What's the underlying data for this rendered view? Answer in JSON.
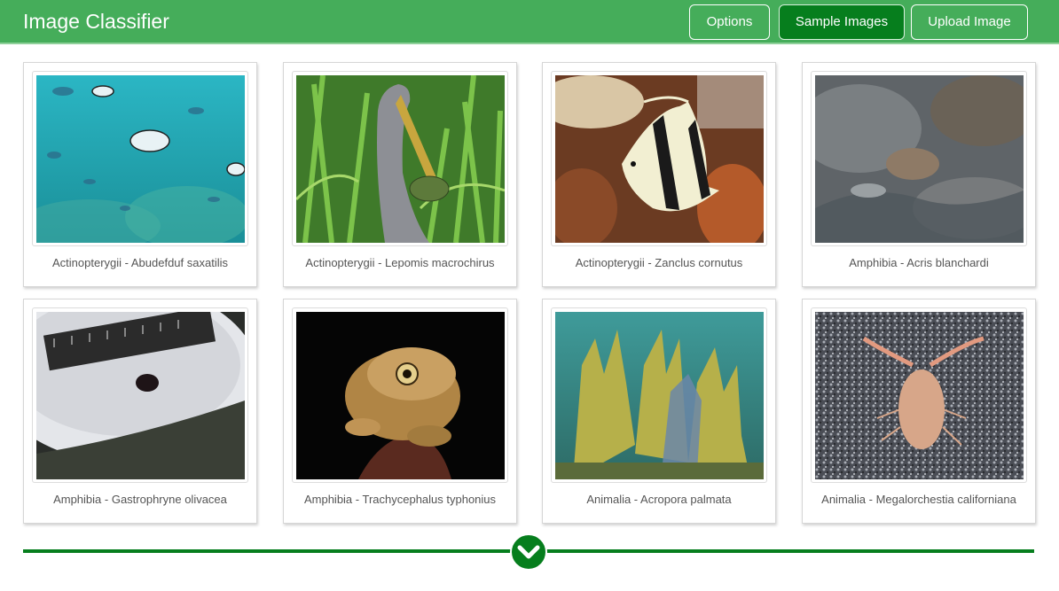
{
  "header": {
    "title": "Image Classifier",
    "options_label": "Options",
    "sample_images_label": "Sample Images",
    "upload_image_label": "Upload Image"
  },
  "gallery": {
    "items": [
      {
        "caption": "Actinopterygii - Abudefduf saxatilis"
      },
      {
        "caption": "Actinopterygii - Lepomis macrochirus"
      },
      {
        "caption": "Actinopterygii - Zanclus cornutus"
      },
      {
        "caption": "Amphibia - Acris blanchardi"
      },
      {
        "caption": "Amphibia - Gastrophryne olivacea"
      },
      {
        "caption": "Amphibia - Trachycephalus typhonius"
      },
      {
        "caption": "Animalia - Acropora palmata"
      },
      {
        "caption": "Animalia - Megalorchestia californiana"
      }
    ]
  },
  "footer": {
    "load_more_icon": "chevron-down-icon"
  },
  "colors": {
    "header_bg": "#45ad5a",
    "active_button": "#067e1d",
    "divider": "#067e1d"
  }
}
